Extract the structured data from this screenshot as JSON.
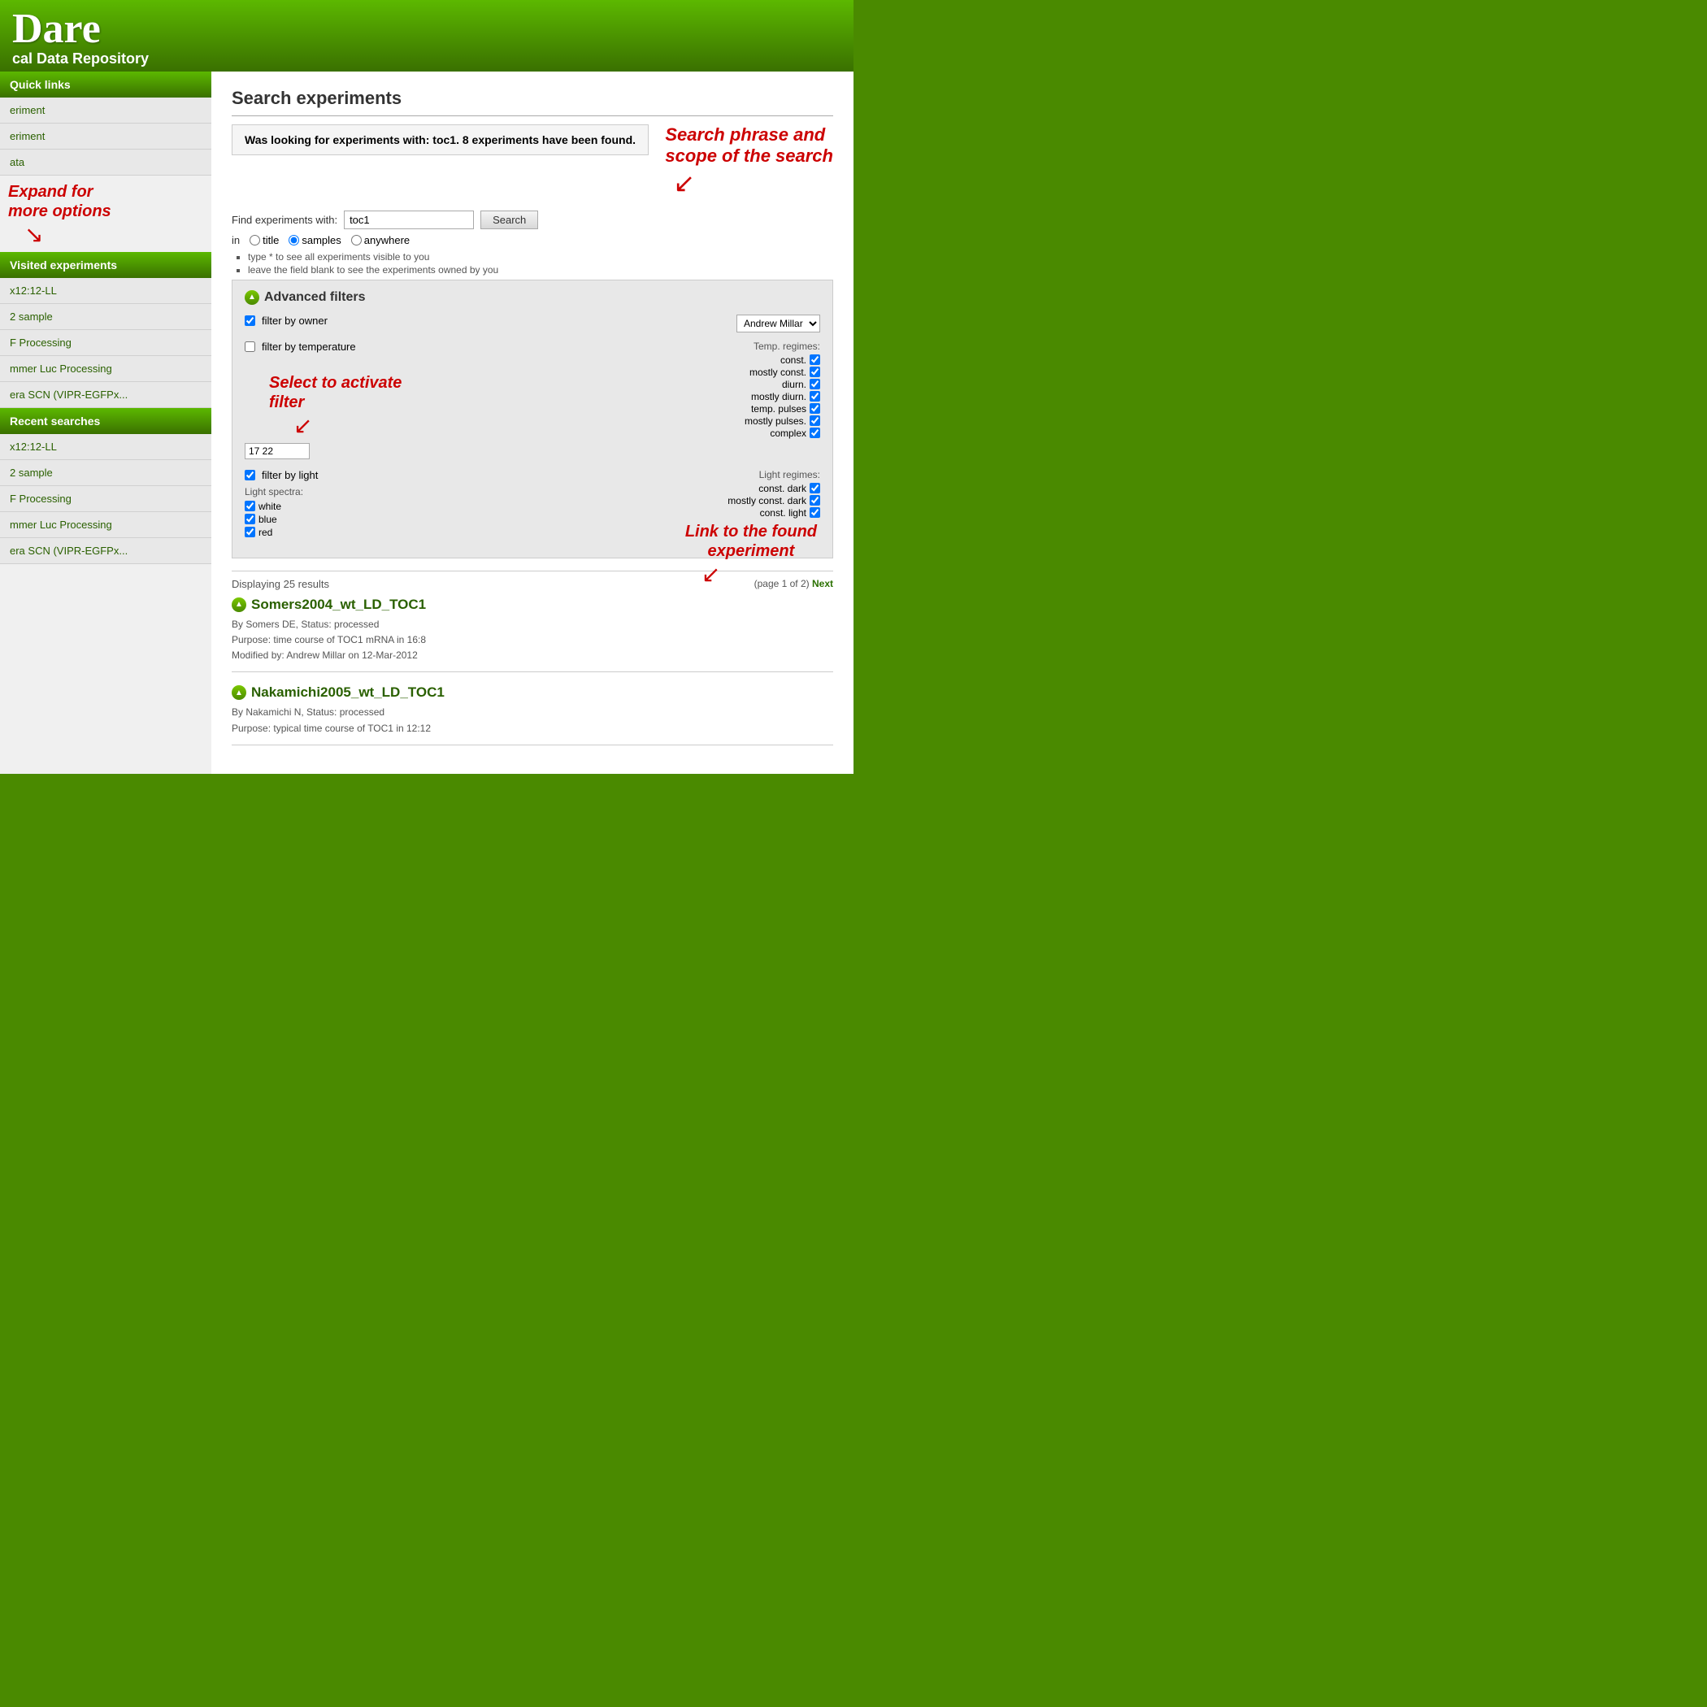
{
  "header": {
    "title": "Dare",
    "subtitle": "cal Data Repository"
  },
  "sidebar": {
    "quick_links_label": "Quick links",
    "quick_links_items": [
      {
        "label": "eriment"
      },
      {
        "label": "eriment"
      },
      {
        "label": "ata"
      }
    ],
    "expand_annotation": "Expand for\nmore options",
    "visited_label": "Visited experiments",
    "visited_items": [
      {
        "label": "x12:12-LL"
      },
      {
        "label": "2 sample"
      },
      {
        "label": "F Processing"
      },
      {
        "label": "mmer Luc Processing"
      },
      {
        "label": "era SCN (VIPR-EGFPx..."
      }
    ],
    "recent_label": "Recent searches",
    "recent_items": [
      {
        "label": "x12:12-LL"
      },
      {
        "label": "2 sample"
      },
      {
        "label": "F Processing"
      },
      {
        "label": "mmer Luc Processing"
      },
      {
        "label": "era SCN (VIPR-EGFPx..."
      }
    ]
  },
  "main": {
    "page_title": "Search experiments",
    "info_box": {
      "text": "Was looking for experiments with: toc1. 8 experiments have been found."
    },
    "annotation_search_phrase": "Search phrase and\nscope of the search",
    "search": {
      "find_label": "Find experiments with:",
      "input_value": "toc1",
      "button_label": "Search",
      "in_label": "in",
      "radio_options": [
        "title",
        "samples",
        "anywhere"
      ],
      "radio_selected": "samples",
      "hints": [
        "type * to see all experiments visible to you",
        "leave the field blank to see the experiments owned by you"
      ]
    },
    "advanced_filters": {
      "header": "Advanced filters",
      "annotation_select_filter": "Select to activate\nfilter",
      "filter_owner": {
        "label": "filter by owner",
        "checked": true,
        "owner_value": "Andrew Millar"
      },
      "filter_temperature": {
        "label": "filter by temperature",
        "checked": false,
        "temp_value": "17 22",
        "temp_label": "Temp. regimes:",
        "regimes": [
          {
            "label": "const.",
            "checked": true
          },
          {
            "label": "mostly const.",
            "checked": true
          },
          {
            "label": "diurn.",
            "checked": true
          },
          {
            "label": "mostly diurn.",
            "checked": true
          },
          {
            "label": "temp. pulses",
            "checked": true
          },
          {
            "label": "mostly pulses.",
            "checked": true
          },
          {
            "label": "complex",
            "checked": true
          }
        ]
      },
      "filter_light": {
        "label": "filter by light",
        "checked": true,
        "light_regimes_label": "Light regimes:",
        "regimes": [
          {
            "label": "const. dark",
            "checked": true
          },
          {
            "label": "mostly const. dark",
            "checked": true
          },
          {
            "label": "const. light",
            "checked": true
          }
        ],
        "spectra_label": "Light spectra:",
        "spectra": [
          {
            "label": "white",
            "checked": true
          },
          {
            "label": "blue",
            "checked": true
          },
          {
            "label": "red",
            "checked": true
          }
        ]
      }
    },
    "results": {
      "displaying_label": "Displaying 25 results",
      "page_info": "(page 1 of 2)",
      "next_label": "Next",
      "annotation_link": "Link to the found\nexperiment",
      "experiments": [
        {
          "id": "exp1",
          "title": "Somers2004_wt_LD_TOC1",
          "meta_line1": "By Somers DE, Status: processed",
          "meta_line2": "Purpose: time course of TOC1 mRNA in 16:8",
          "meta_line3": "Modified by: Andrew Millar on 12-Mar-2012"
        },
        {
          "id": "exp2",
          "title": "Nakamichi2005_wt_LD_TOC1",
          "meta_line1": "By Nakamichi N, Status: processed",
          "meta_line2": "Purpose: typical time course of TOC1 in 12:12",
          "meta_line3": ""
        }
      ]
    }
  }
}
